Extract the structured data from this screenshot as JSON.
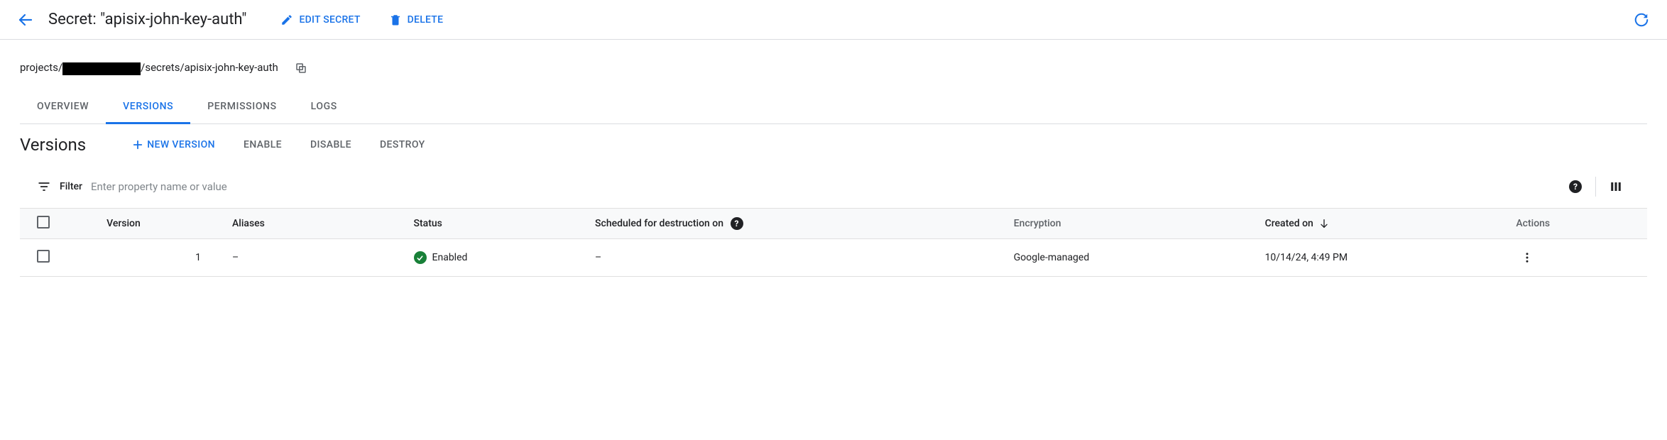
{
  "header": {
    "title": "Secret: \"apisix-john-key-auth\"",
    "edit_label": "EDIT SECRET",
    "delete_label": "DELETE"
  },
  "path": {
    "prefix": "projects/",
    "suffix": "/secrets/apisix-john-key-auth"
  },
  "tabs": [
    {
      "label": "OVERVIEW",
      "active": false
    },
    {
      "label": "VERSIONS",
      "active": true
    },
    {
      "label": "PERMISSIONS",
      "active": false
    },
    {
      "label": "LOGS",
      "active": false
    }
  ],
  "versions_section": {
    "title": "Versions",
    "new_label": "NEW VERSION",
    "enable_label": "ENABLE",
    "disable_label": "DISABLE",
    "destroy_label": "DESTROY"
  },
  "filter": {
    "label": "Filter",
    "placeholder": "Enter property name or value"
  },
  "table": {
    "headers": {
      "version": "Version",
      "aliases": "Aliases",
      "status": "Status",
      "scheduled": "Scheduled for destruction on",
      "encryption": "Encryption",
      "created": "Created on",
      "actions": "Actions"
    },
    "rows": [
      {
        "version": "1",
        "aliases": "–",
        "status": "Enabled",
        "scheduled": "–",
        "encryption": "Google-managed",
        "created": "10/14/24, 4:49 PM"
      }
    ]
  }
}
